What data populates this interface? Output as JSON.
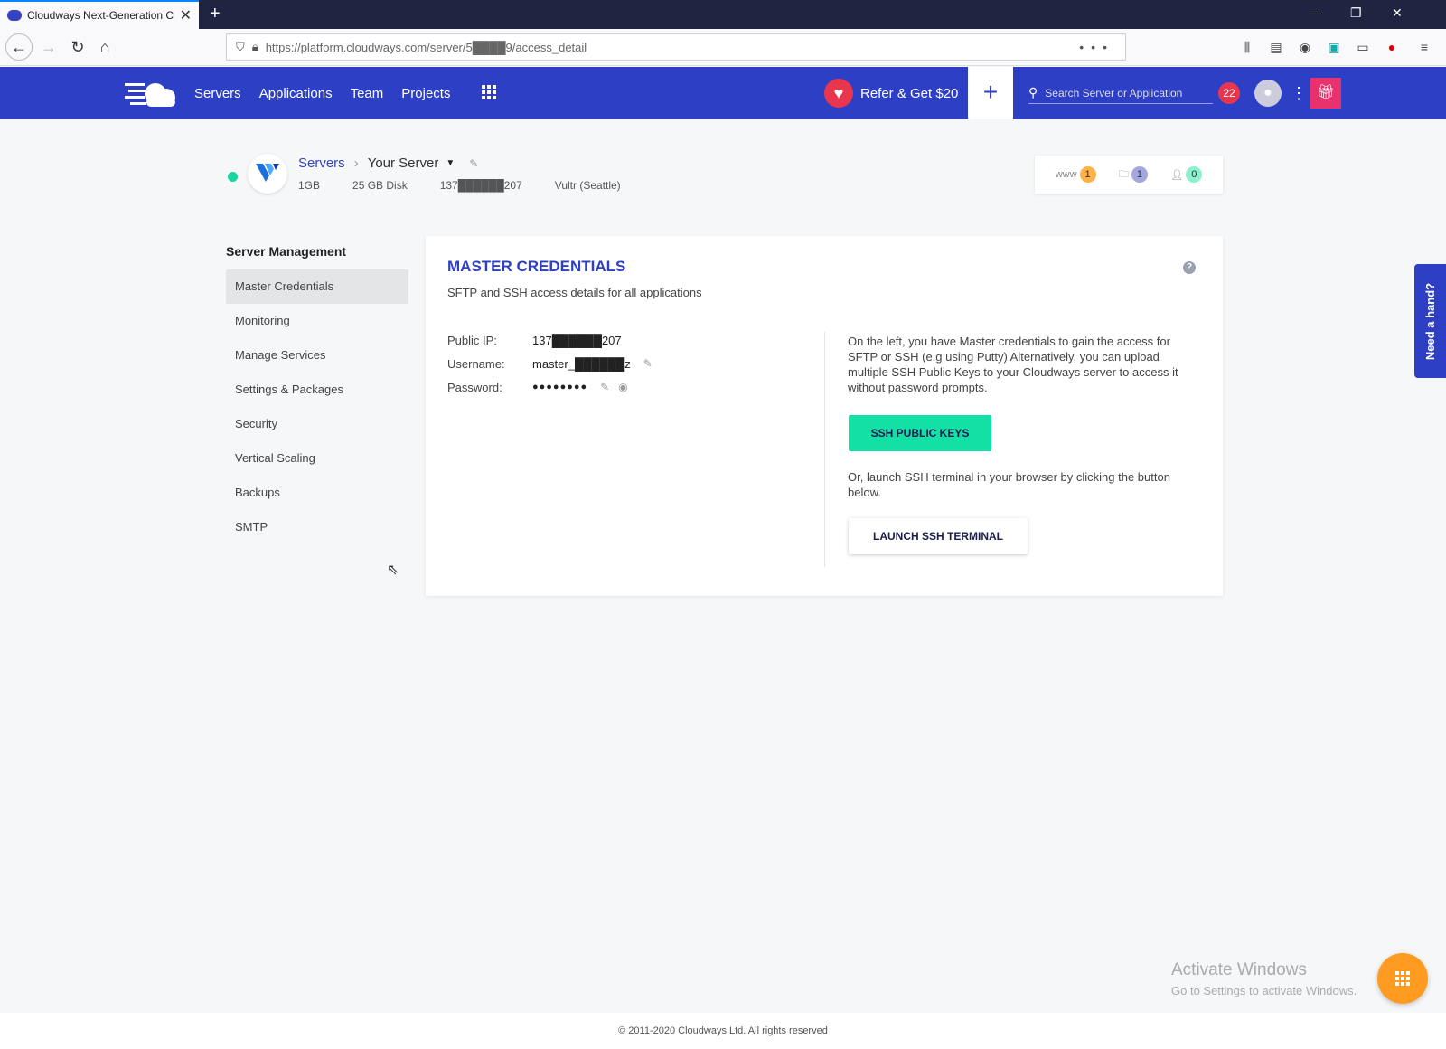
{
  "browser": {
    "tab_title": "Cloudways Next-Generation Cl",
    "url": "https://platform.cloudways.com/server/5████9/access_detail"
  },
  "header": {
    "nav": [
      "Servers",
      "Applications",
      "Team",
      "Projects"
    ],
    "refer_label": "Refer & Get $20",
    "plus_label": "+",
    "search_placeholder": "Search Server or Application",
    "notifications_count": "22"
  },
  "server": {
    "breadcrumb_root": "Servers",
    "name": "Your Server",
    "size": "1GB",
    "disk": "25 GB Disk",
    "ip": "137██████207",
    "location": "Vultr (Seattle)",
    "counters": {
      "www_label": "www",
      "www": "1",
      "files": "1",
      "users": "0"
    }
  },
  "sidebar": {
    "title": "Server Management",
    "items": [
      "Master Credentials",
      "Monitoring",
      "Manage Services",
      "Settings & Packages",
      "Security",
      "Vertical Scaling",
      "Backups",
      "SMTP"
    ],
    "active": "Master Credentials"
  },
  "card": {
    "title": "MASTER CREDENTIALS",
    "subtitle": "SFTP and SSH access details for all applications",
    "help": "?",
    "public_ip_label": "Public IP:",
    "public_ip": "137██████207",
    "username_label": "Username:",
    "username": "master_██████z",
    "password_label": "Password:",
    "password": "●●●●●●●●",
    "info_text": "On the left, you have Master credentials to gain the access for SFTP or SSH (e.g using Putty) Alternatively, you can upload multiple SSH Public Keys to your Cloudways server to access it without password prompts.",
    "ssh_keys_button": "SSH PUBLIC KEYS",
    "terminal_text": "Or, launch SSH terminal in your browser by clicking the button below.",
    "terminal_button": "LAUNCH SSH TERMINAL"
  },
  "need_hand": "Need a hand?",
  "activate_windows": {
    "title": "Activate Windows",
    "subtitle": "Go to Settings to activate Windows."
  },
  "footer": "© 2011-2020 Cloudways Ltd. All rights reserved",
  "colors": {
    "brand": "#2d3fc4",
    "accent": "#13e0a5",
    "alert": "#e8364e",
    "fab": "#ff9b21"
  }
}
